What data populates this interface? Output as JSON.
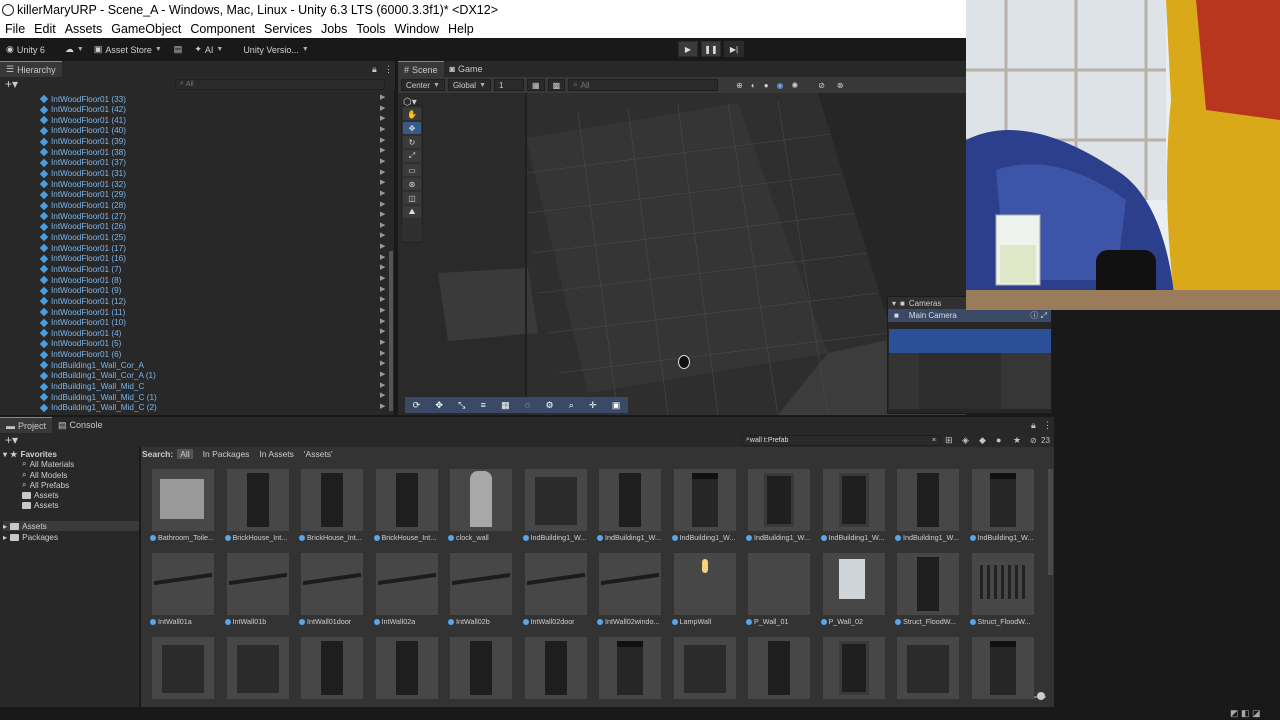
{
  "window": {
    "title": "killerMaryURP - Scene_A - Windows, Mac, Linux - Unity 6.3 LTS (6000.3.3f1)* <DX12>"
  },
  "menu": [
    "File",
    "Edit",
    "Assets",
    "GameObject",
    "Component",
    "Services",
    "Jobs",
    "Tools",
    "Window",
    "Help"
  ],
  "toolbar": {
    "unity": "Unity 6",
    "asset_store": "Asset Store",
    "ai": "AI",
    "version": "Unity Versio..."
  },
  "hierarchy": {
    "tab": "Hierarchy",
    "search_placeholder": "All",
    "items": [
      "IntWoodFloor01 (33)",
      "IntWoodFloor01 (42)",
      "IntWoodFloor01 (41)",
      "IntWoodFloor01 (40)",
      "IntWoodFloor01 (39)",
      "IntWoodFloor01 (38)",
      "IntWoodFloor01 (37)",
      "IntWoodFloor01 (31)",
      "IntWoodFloor01 (32)",
      "IntWoodFloor01 (29)",
      "IntWoodFloor01 (28)",
      "IntWoodFloor01 (27)",
      "IntWoodFloor01 (26)",
      "IntWoodFloor01 (25)",
      "IntWoodFloor01 (17)",
      "IntWoodFloor01 (16)",
      "IntWoodFloor01 (7)",
      "IntWoodFloor01 (8)",
      "IntWoodFloor01 (9)",
      "IntWoodFloor01 (12)",
      "IntWoodFloor01 (11)",
      "IntWoodFloor01 (10)",
      "IntWoodFloor01 (4)",
      "IntWoodFloor01 (5)",
      "IntWoodFloor01 (6)",
      "IndBuilding1_Wall_Cor_A",
      "IndBuilding1_Wall_Cor_A (1)",
      "IndBuilding1_Wall_Mid_C",
      "IndBuilding1_Wall_Mid_C (1)",
      "IndBuilding1_Wall_Mid_C (2)"
    ]
  },
  "scene": {
    "tab_scene": "Scene",
    "tab_game": "Game",
    "pivot": "Center",
    "space": "Global",
    "snap": "1",
    "search_placeholder": "All"
  },
  "cameras": {
    "title": "Cameras",
    "selected": "Main Camera"
  },
  "project": {
    "tab_project": "Project",
    "tab_console": "Console",
    "search_value": "wall t:Prefab",
    "count": "23",
    "search_label": "Search:",
    "filters": [
      "All",
      "In Packages",
      "In Assets",
      "'Assets'"
    ],
    "favorites": {
      "label": "Favorites",
      "items": [
        "All Materials",
        "All Models",
        "All Prefabs",
        "Assets",
        "Assets"
      ]
    },
    "roots": [
      "Assets",
      "Packages"
    ],
    "row1": [
      "Bathroom_Toile...",
      "BrickHouse_Int...",
      "BrickHouse_Int...",
      "BrickHouse_Int...",
      "clock_wall",
      "IndBuilding1_W...",
      "IndBuilding1_W...",
      "IndBuilding1_W...",
      "IndBuilding1_W...",
      "IndBuilding1_W...",
      "IndBuilding1_W...",
      "IndBuilding1_W..."
    ],
    "row2": [
      "IntWall01a",
      "IntWall01b",
      "IntWall01door",
      "IntWall02a",
      "IntWall02b",
      "IntWall02door",
      "IntWall02windo...",
      "LampWall",
      "P_Wall_01",
      "P_Wall_02",
      "Struct_FloodW...",
      "Struct_FloodW..."
    ]
  },
  "colors": {
    "accent": "#3a72c6",
    "hier_text": "#7cb6e8"
  }
}
